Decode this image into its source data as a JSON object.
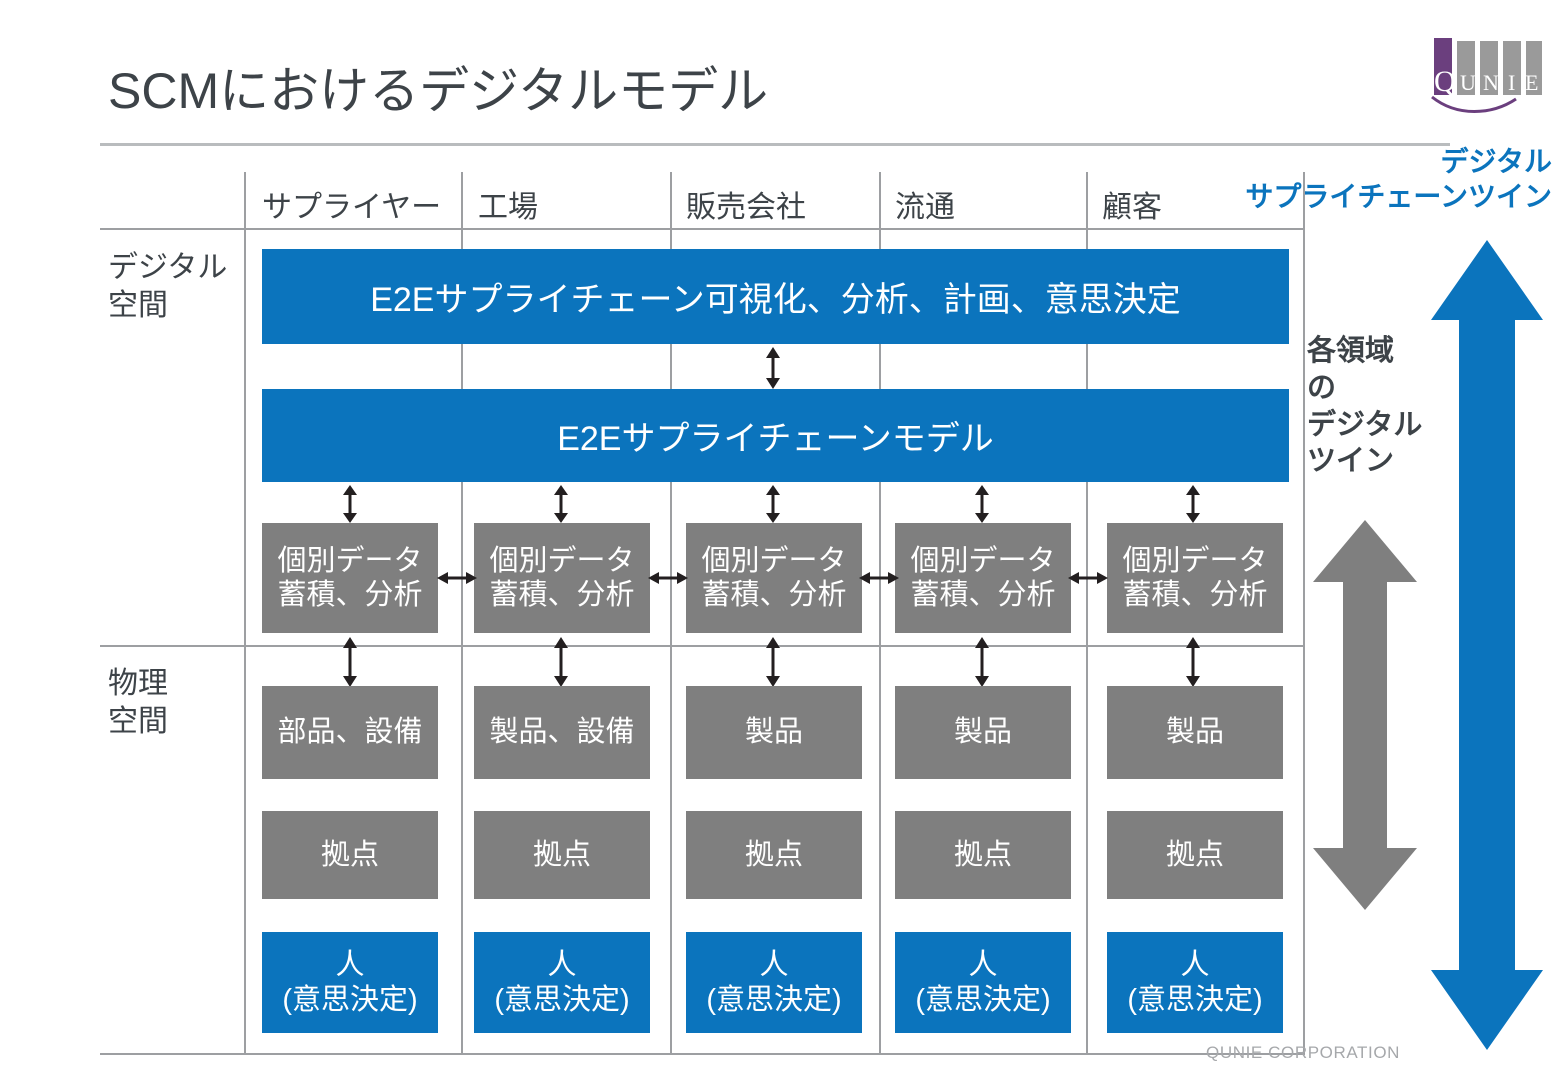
{
  "slide": {
    "title": "SCMにおけるデジタルモデル",
    "footer": "QUNIE CORPORATION",
    "logo_text": "QUNIE",
    "accent_blue": "#0b74bd",
    "grey_box": "#7f7f7f",
    "rule_grey": "#9d9fa2",
    "text_dark": "#3d4348",
    "logo_purple": "#6b3f7e"
  },
  "columns": [
    {
      "label": "サプライヤー"
    },
    {
      "label": "工場"
    },
    {
      "label": "販売会社"
    },
    {
      "label": "流通"
    },
    {
      "label": "顧客"
    }
  ],
  "bands": {
    "digital": "デジタル\n空間",
    "digital_line1": "デジタル",
    "digital_line2": "空間",
    "physical_line1": "物理",
    "physical_line2": "空間"
  },
  "digital_space": {
    "top_bar": "E2Eサプライチェーン可視化、分析、計画、意思決定",
    "model_bar": "E2Eサプライチェーンモデル",
    "per_column_box_line1": "個別データ",
    "per_column_box_line2": "蓄積、分析"
  },
  "physical_space": {
    "assets": [
      "部品、設備",
      "製品、設備",
      "製品",
      "製品",
      "製品"
    ],
    "sites": [
      "拠点",
      "拠点",
      "拠点",
      "拠点",
      "拠点"
    ],
    "people_line1": "人",
    "people_line2": "（意思決定）",
    "people": [
      {
        "l1": "人",
        "l2": "(意思決定)"
      },
      {
        "l1": "人",
        "l2": "(意思決定)"
      },
      {
        "l1": "人",
        "l2": "(意思決定)"
      },
      {
        "l1": "人",
        "l2": "(意思決定)"
      },
      {
        "l1": "人",
        "l2": "(意思決定)"
      }
    ]
  },
  "right_panel": {
    "headline_line1": "デジタル",
    "headline_line2": "サプライチェーンツイン",
    "domain_twin_line1": "各領域",
    "domain_twin_line2": "の",
    "domain_twin_line3": "デジタル",
    "domain_twin_line4": "ツイン"
  }
}
